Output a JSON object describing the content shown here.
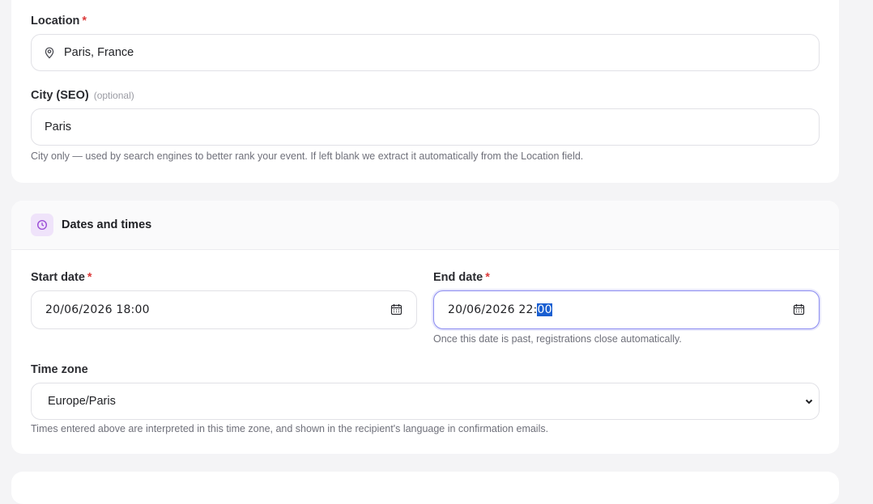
{
  "location": {
    "label": "Location",
    "required_mark": "*",
    "value": "Paris, France",
    "icon": "map-pin-icon"
  },
  "city": {
    "label": "City (SEO)",
    "optional_text": "(optional)",
    "value": "Paris",
    "help": "City only — used by search engines to better rank your event. If left blank we extract it automatically from the Location field."
  },
  "dates_section": {
    "title": "Dates and times",
    "icon": "clock-icon",
    "icon_color": "#9b4dd6",
    "start": {
      "label": "Start date",
      "required_mark": "*",
      "value": "20/06/2026 18:00",
      "icon": "calendar-icon"
    },
    "end": {
      "label": "End date",
      "required_mark": "*",
      "value_prefix": "20/06/2026 22:",
      "value_selected": "00",
      "help": "Once this date is past, registrations close automatically.",
      "icon": "calendar-icon"
    },
    "timezone": {
      "label": "Time zone",
      "selected": "Europe/Paris",
      "help": "Times entered above are interpreted in this time zone, and shown in the recipient's language in confirmation emails."
    }
  },
  "colors": {
    "required": "#dc3b3b",
    "focus_border": "#8b8cf0",
    "selection": "#1a5fd1"
  }
}
